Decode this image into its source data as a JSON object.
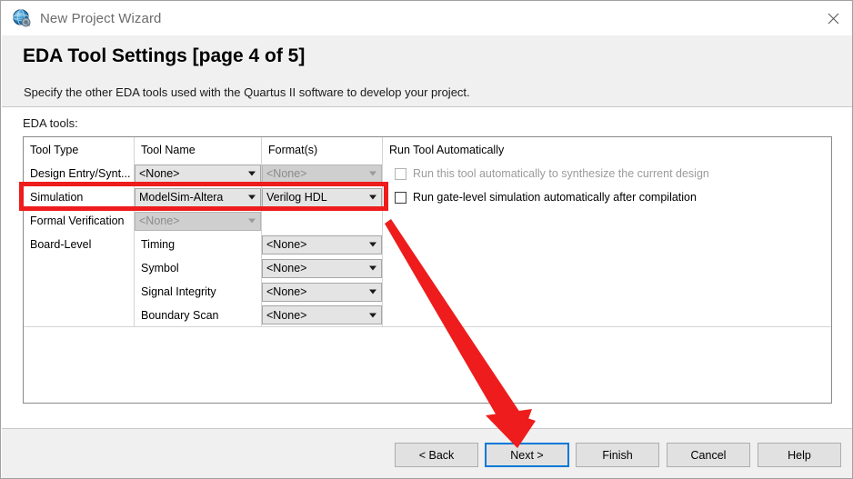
{
  "window": {
    "title": "New Project Wizard",
    "icon": "quartus-globe-icon",
    "close_icon": "close-icon"
  },
  "header": {
    "title": "EDA Tool Settings [page 4 of 5]",
    "subtitle": "Specify the other EDA tools used with the Quartus II software to develop your project."
  },
  "content": {
    "eda_tools_label": "EDA tools:"
  },
  "table": {
    "columns": [
      "Tool Type",
      "Tool Name",
      "Format(s)",
      "Run Tool Automatically"
    ],
    "rows": [
      {
        "tool_type": "Design Entry/Synt...",
        "tool_name": "<None>",
        "tool_name_disabled": false,
        "format": "<None>",
        "format_disabled": true,
        "checkbox_label": "Run this tool automatically to synthesize the current design",
        "checkbox_disabled": true,
        "checkbox_checked": false
      },
      {
        "tool_type": "Simulation",
        "tool_name": "ModelSim-Altera",
        "tool_name_disabled": false,
        "format": "Verilog HDL",
        "format_disabled": false,
        "checkbox_label": "Run gate-level simulation automatically after compilation",
        "checkbox_disabled": false,
        "checkbox_checked": false
      },
      {
        "tool_type": "Formal Verification",
        "tool_name": "<None>",
        "tool_name_disabled": true,
        "format": "",
        "format_disabled": null,
        "checkbox_label": "",
        "checkbox_disabled": null,
        "checkbox_checked": false
      },
      {
        "tool_type": "Board-Level",
        "tool_name": "Timing",
        "tool_name_disabled": null,
        "format": "<None>",
        "format_disabled": false,
        "checkbox_label": "",
        "checkbox_disabled": null,
        "checkbox_checked": false
      },
      {
        "tool_type": "",
        "tool_name": "Symbol",
        "tool_name_disabled": null,
        "format": "<None>",
        "format_disabled": false,
        "checkbox_label": "",
        "checkbox_disabled": null,
        "checkbox_checked": false
      },
      {
        "tool_type": "",
        "tool_name": "Signal Integrity",
        "tool_name_disabled": null,
        "format": "<None>",
        "format_disabled": false,
        "checkbox_label": "",
        "checkbox_disabled": null,
        "checkbox_checked": false
      },
      {
        "tool_type": "",
        "tool_name": "Boundary Scan",
        "tool_name_disabled": null,
        "format": "<None>",
        "format_disabled": false,
        "checkbox_label": "",
        "checkbox_disabled": null,
        "checkbox_checked": false
      }
    ]
  },
  "buttons": {
    "back": "< Back",
    "next": "Next >",
    "finish": "Finish",
    "cancel": "Cancel",
    "help": "Help",
    "focused": "Next >"
  },
  "annotations": {
    "highlight_color": "#ee1c1c",
    "highlight_target": "Simulation row",
    "arrow_color": "#ee1c1c",
    "arrow_from": "Simulation row right edge",
    "arrow_to": "Next > button"
  },
  "colors": {
    "accent": "#0078d7",
    "annotation_red": "#ee1c1c",
    "panel_background": "#f0f0f0",
    "window_background": "#ffffff"
  }
}
